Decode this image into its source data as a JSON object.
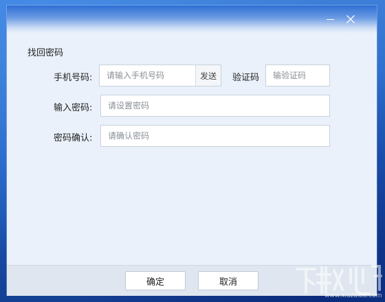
{
  "window": {
    "minimize_icon": "minimize-icon",
    "close_icon": "close-icon"
  },
  "form": {
    "title": "找回密码",
    "phone": {
      "label": "手机号码:",
      "placeholder": "请输入手机号码",
      "value": ""
    },
    "send_button": "发送",
    "code": {
      "label": "验证码",
      "placeholder": "输验证码",
      "value": ""
    },
    "new_password": {
      "label": "输入密码:",
      "placeholder": "请设置密码",
      "value": ""
    },
    "confirm_password": {
      "label": "密码确认:",
      "placeholder": "请确认密码",
      "value": ""
    }
  },
  "footer": {
    "confirm_button": "确定",
    "cancel_button": "取消"
  },
  "watermark": {
    "brand": "下载吧",
    "url": "www.xiazaiba.com"
  },
  "colors": {
    "dialog_bg": "#eaf1fb",
    "titlebar_top": "#2e6fd5",
    "input_border": "#c8d0da"
  }
}
